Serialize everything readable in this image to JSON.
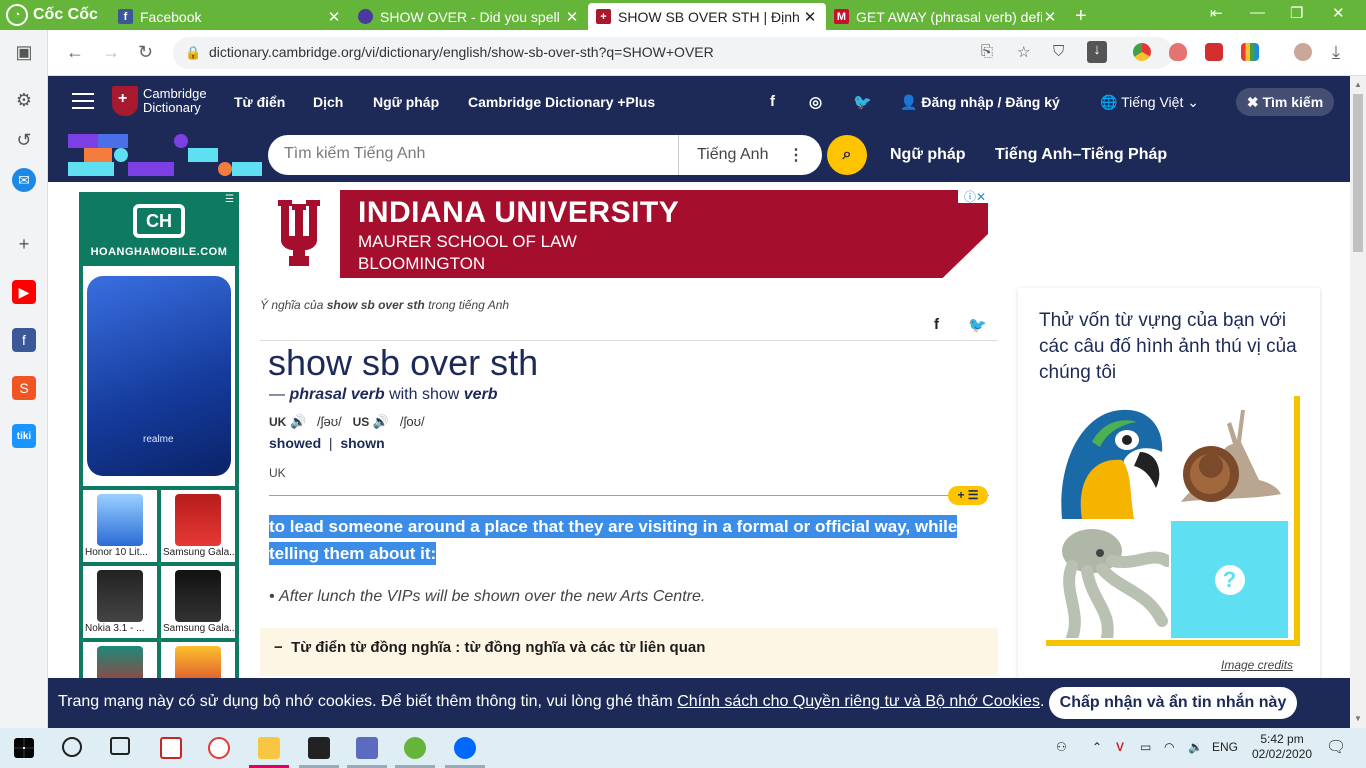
{
  "browser": {
    "brand": "Cốc Cốc",
    "tabs": [
      {
        "title": "Facebook"
      },
      {
        "title": "SHOW OVER - Did you spell it"
      },
      {
        "title": "SHOW SB OVER STH | Định ng"
      },
      {
        "title": "GET AWAY (phrasal verb) defi"
      }
    ],
    "url": "dictionary.cambridge.org/vi/dictionary/english/show-sb-over-sth?q=SHOW+OVER"
  },
  "site": {
    "logo_line1": "Cambridge",
    "logo_line2": "Dictionary",
    "nav": [
      "Từ điển",
      "Dịch",
      "Ngữ pháp",
      "Cambridge Dictionary +Plus"
    ],
    "login": "Đăng nhập / Đăng ký",
    "language": "Tiếng Việt",
    "search_pill": "Tìm kiếm",
    "search_placeholder": "Tìm kiếm Tiếng Anh",
    "search_lang": "Tiếng Anh",
    "band_links": [
      "Ngữ pháp",
      "Tiếng Anh–Tiếng Pháp"
    ]
  },
  "left_ad": {
    "site": "HOANGHAMOBILE.COM",
    "hero_brand": "realme",
    "items": [
      "Honor 10 Lit...",
      "Samsung Gala...",
      "Nokia 3.1 - ...",
      "Samsung Gala..."
    ]
  },
  "banner": {
    "line1": "INDIANA UNIVERSITY",
    "line2": "MAURER SCHOOL OF LAW",
    "line3": "BLOOMINGTON"
  },
  "entry": {
    "crumb_prefix": "Ý nghĩa của",
    "crumb_term": "show sb over sth",
    "crumb_suffix": "trong tiếng Anh",
    "headword": "show sb over sth",
    "pos_dash": "—",
    "pos": "phrasal verb",
    "pos_with": "with show",
    "pos_verb": "verb",
    "uk_label": "UK",
    "uk_ipa": "/ʃəʊ/",
    "us_label": "US",
    "us_ipa": "/ʃoʊ/",
    "form1": "showed",
    "form_sep": "|",
    "form2": "shown",
    "region": "UK",
    "plus_list": "+ ☰",
    "definition": "to lead someone around a place that they are visiting in a formal or official way, while telling them about it:",
    "example": "After lunch the VIPs will be shown over the new Arts Centre.",
    "synonyms": "Từ điển từ đồng nghĩa : từ đồng nghĩa và các từ liên quan"
  },
  "quiz": {
    "question": "Thử vốn từ vựng của bạn với các câu đố hình ảnh thú vị của chúng tôi",
    "mystery": "?",
    "credits": "Image credits"
  },
  "cookie": {
    "message": "Trang mạng này có sử dụng bộ nhớ cookies. Để biết thêm thông tin, vui lòng ghé thăm",
    "link": "Chính sách cho Quyền riêng tư và Bộ nhớ Cookies",
    "end": ".",
    "accept": "Chấp nhận và ẩn tin nhắn này"
  },
  "taskbar": {
    "lang": "ENG",
    "time": "5:42 pm",
    "date": "02/02/2020"
  },
  "colors": {
    "cambridge_navy": "#1d2a57",
    "accent_yellow": "#fec400",
    "coccoc_green": "#64b53a",
    "highlight": "#3b8de8"
  }
}
